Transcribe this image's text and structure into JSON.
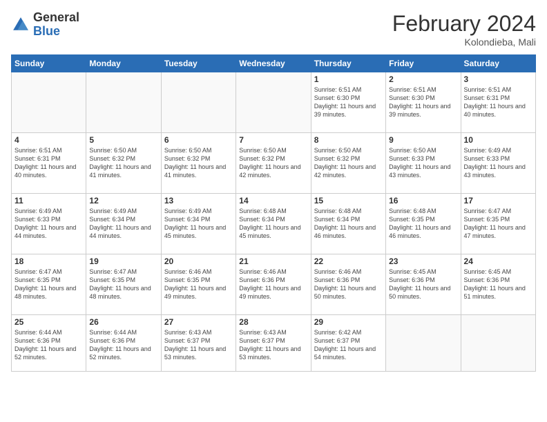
{
  "header": {
    "logo_general": "General",
    "logo_blue": "Blue",
    "month_title": "February 2024",
    "location": "Kolondieba, Mali"
  },
  "weekdays": [
    "Sunday",
    "Monday",
    "Tuesday",
    "Wednesday",
    "Thursday",
    "Friday",
    "Saturday"
  ],
  "weeks": [
    [
      {
        "day": "",
        "sunrise": "",
        "sunset": "",
        "daylight": ""
      },
      {
        "day": "",
        "sunrise": "",
        "sunset": "",
        "daylight": ""
      },
      {
        "day": "",
        "sunrise": "",
        "sunset": "",
        "daylight": ""
      },
      {
        "day": "",
        "sunrise": "",
        "sunset": "",
        "daylight": ""
      },
      {
        "day": "1",
        "sunrise": "Sunrise: 6:51 AM",
        "sunset": "Sunset: 6:30 PM",
        "daylight": "Daylight: 11 hours and 39 minutes."
      },
      {
        "day": "2",
        "sunrise": "Sunrise: 6:51 AM",
        "sunset": "Sunset: 6:30 PM",
        "daylight": "Daylight: 11 hours and 39 minutes."
      },
      {
        "day": "3",
        "sunrise": "Sunrise: 6:51 AM",
        "sunset": "Sunset: 6:31 PM",
        "daylight": "Daylight: 11 hours and 40 minutes."
      }
    ],
    [
      {
        "day": "4",
        "sunrise": "Sunrise: 6:51 AM",
        "sunset": "Sunset: 6:31 PM",
        "daylight": "Daylight: 11 hours and 40 minutes."
      },
      {
        "day": "5",
        "sunrise": "Sunrise: 6:50 AM",
        "sunset": "Sunset: 6:32 PM",
        "daylight": "Daylight: 11 hours and 41 minutes."
      },
      {
        "day": "6",
        "sunrise": "Sunrise: 6:50 AM",
        "sunset": "Sunset: 6:32 PM",
        "daylight": "Daylight: 11 hours and 41 minutes."
      },
      {
        "day": "7",
        "sunrise": "Sunrise: 6:50 AM",
        "sunset": "Sunset: 6:32 PM",
        "daylight": "Daylight: 11 hours and 42 minutes."
      },
      {
        "day": "8",
        "sunrise": "Sunrise: 6:50 AM",
        "sunset": "Sunset: 6:32 PM",
        "daylight": "Daylight: 11 hours and 42 minutes."
      },
      {
        "day": "9",
        "sunrise": "Sunrise: 6:50 AM",
        "sunset": "Sunset: 6:33 PM",
        "daylight": "Daylight: 11 hours and 43 minutes."
      },
      {
        "day": "10",
        "sunrise": "Sunrise: 6:49 AM",
        "sunset": "Sunset: 6:33 PM",
        "daylight": "Daylight: 11 hours and 43 minutes."
      }
    ],
    [
      {
        "day": "11",
        "sunrise": "Sunrise: 6:49 AM",
        "sunset": "Sunset: 6:33 PM",
        "daylight": "Daylight: 11 hours and 44 minutes."
      },
      {
        "day": "12",
        "sunrise": "Sunrise: 6:49 AM",
        "sunset": "Sunset: 6:34 PM",
        "daylight": "Daylight: 11 hours and 44 minutes."
      },
      {
        "day": "13",
        "sunrise": "Sunrise: 6:49 AM",
        "sunset": "Sunset: 6:34 PM",
        "daylight": "Daylight: 11 hours and 45 minutes."
      },
      {
        "day": "14",
        "sunrise": "Sunrise: 6:48 AM",
        "sunset": "Sunset: 6:34 PM",
        "daylight": "Daylight: 11 hours and 45 minutes."
      },
      {
        "day": "15",
        "sunrise": "Sunrise: 6:48 AM",
        "sunset": "Sunset: 6:34 PM",
        "daylight": "Daylight: 11 hours and 46 minutes."
      },
      {
        "day": "16",
        "sunrise": "Sunrise: 6:48 AM",
        "sunset": "Sunset: 6:35 PM",
        "daylight": "Daylight: 11 hours and 46 minutes."
      },
      {
        "day": "17",
        "sunrise": "Sunrise: 6:47 AM",
        "sunset": "Sunset: 6:35 PM",
        "daylight": "Daylight: 11 hours and 47 minutes."
      }
    ],
    [
      {
        "day": "18",
        "sunrise": "Sunrise: 6:47 AM",
        "sunset": "Sunset: 6:35 PM",
        "daylight": "Daylight: 11 hours and 48 minutes."
      },
      {
        "day": "19",
        "sunrise": "Sunrise: 6:47 AM",
        "sunset": "Sunset: 6:35 PM",
        "daylight": "Daylight: 11 hours and 48 minutes."
      },
      {
        "day": "20",
        "sunrise": "Sunrise: 6:46 AM",
        "sunset": "Sunset: 6:35 PM",
        "daylight": "Daylight: 11 hours and 49 minutes."
      },
      {
        "day": "21",
        "sunrise": "Sunrise: 6:46 AM",
        "sunset": "Sunset: 6:36 PM",
        "daylight": "Daylight: 11 hours and 49 minutes."
      },
      {
        "day": "22",
        "sunrise": "Sunrise: 6:46 AM",
        "sunset": "Sunset: 6:36 PM",
        "daylight": "Daylight: 11 hours and 50 minutes."
      },
      {
        "day": "23",
        "sunrise": "Sunrise: 6:45 AM",
        "sunset": "Sunset: 6:36 PM",
        "daylight": "Daylight: 11 hours and 50 minutes."
      },
      {
        "day": "24",
        "sunrise": "Sunrise: 6:45 AM",
        "sunset": "Sunset: 6:36 PM",
        "daylight": "Daylight: 11 hours and 51 minutes."
      }
    ],
    [
      {
        "day": "25",
        "sunrise": "Sunrise: 6:44 AM",
        "sunset": "Sunset: 6:36 PM",
        "daylight": "Daylight: 11 hours and 52 minutes."
      },
      {
        "day": "26",
        "sunrise": "Sunrise: 6:44 AM",
        "sunset": "Sunset: 6:36 PM",
        "daylight": "Daylight: 11 hours and 52 minutes."
      },
      {
        "day": "27",
        "sunrise": "Sunrise: 6:43 AM",
        "sunset": "Sunset: 6:37 PM",
        "daylight": "Daylight: 11 hours and 53 minutes."
      },
      {
        "day": "28",
        "sunrise": "Sunrise: 6:43 AM",
        "sunset": "Sunset: 6:37 PM",
        "daylight": "Daylight: 11 hours and 53 minutes."
      },
      {
        "day": "29",
        "sunrise": "Sunrise: 6:42 AM",
        "sunset": "Sunset: 6:37 PM",
        "daylight": "Daylight: 11 hours and 54 minutes."
      },
      {
        "day": "",
        "sunrise": "",
        "sunset": "",
        "daylight": ""
      },
      {
        "day": "",
        "sunrise": "",
        "sunset": "",
        "daylight": ""
      }
    ]
  ]
}
